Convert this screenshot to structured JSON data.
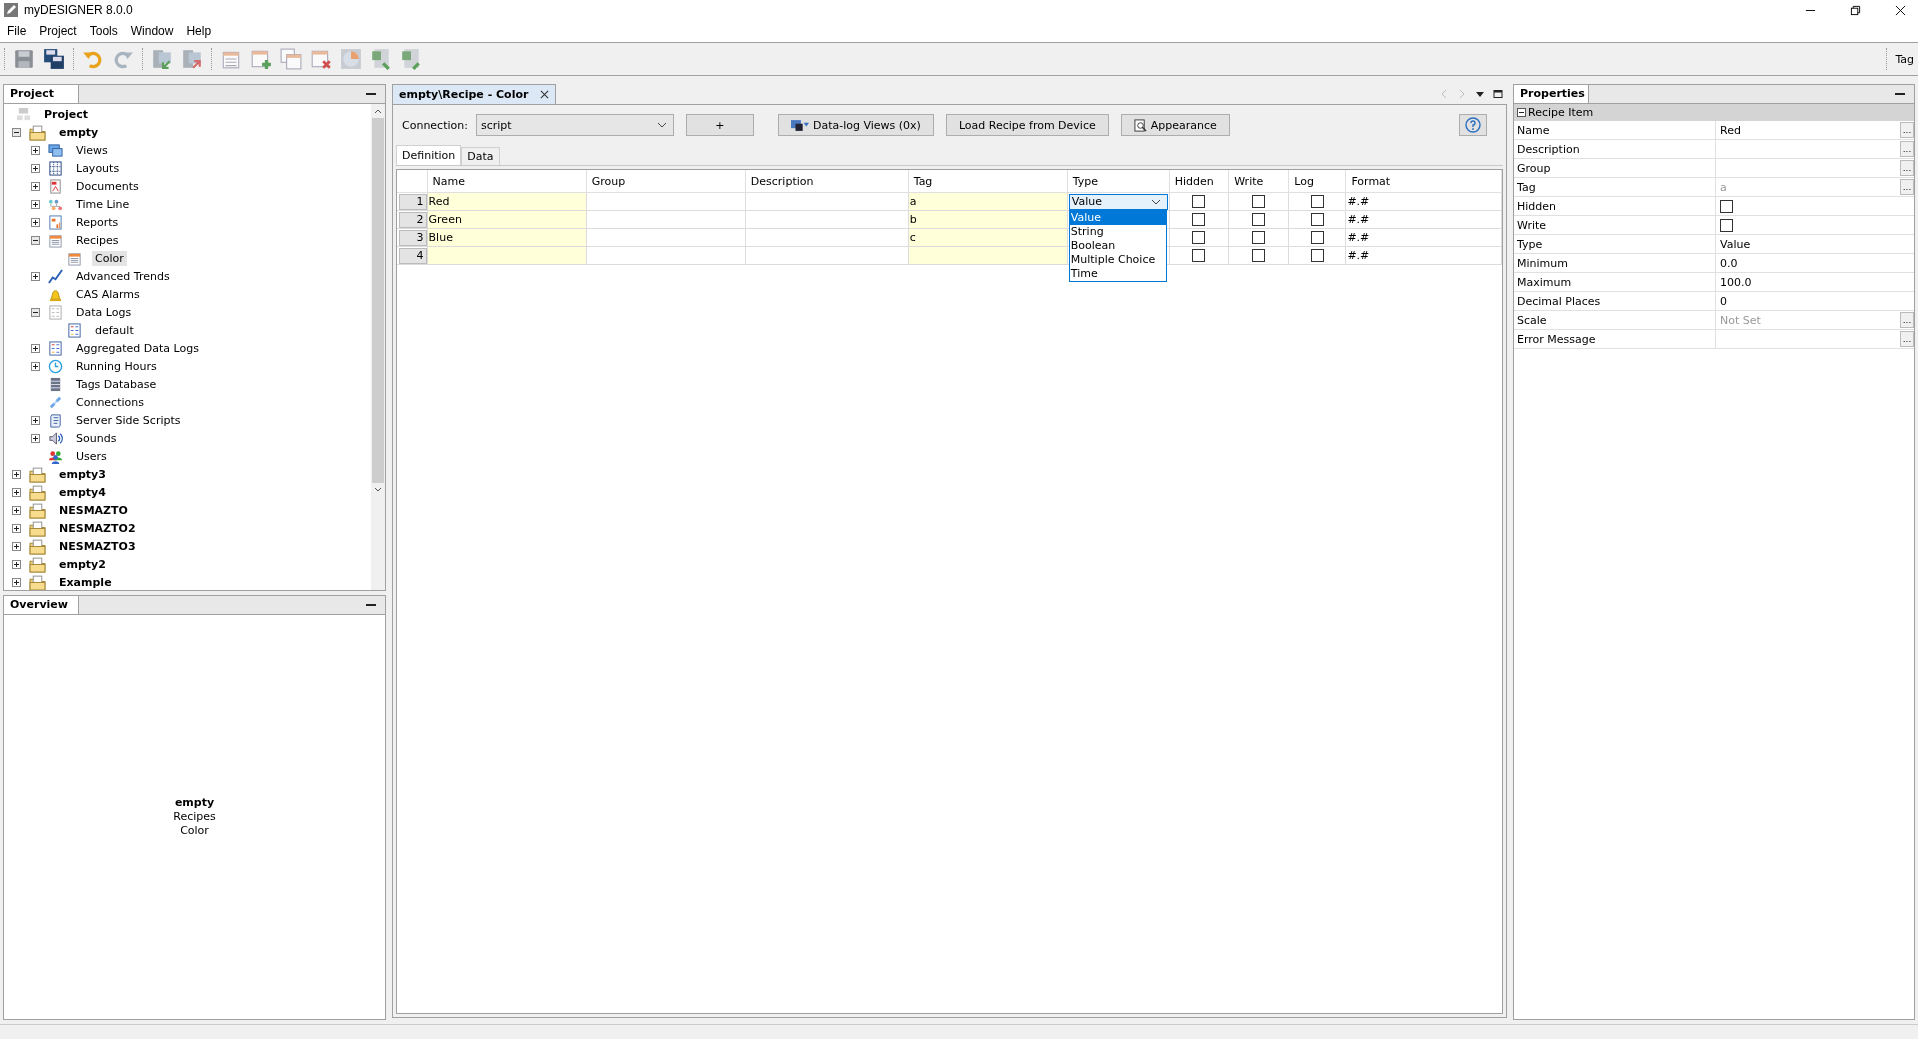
{
  "app": {
    "title": "myDESIGNER 8.0.0"
  },
  "menu": [
    "File",
    "Project",
    "Tools",
    "Window",
    "Help"
  ],
  "toolbar": {
    "label": "Tag"
  },
  "project_panel": {
    "title": "Project",
    "root": "Project",
    "tree": [
      {
        "label": "empty",
        "kind": "folder",
        "bold": true,
        "expanded": true,
        "selected": false,
        "children": [
          {
            "label": "Views",
            "kind": "views",
            "bold": false,
            "expanded": false,
            "selected": false
          },
          {
            "label": "Layouts",
            "kind": "layouts",
            "bold": false,
            "expanded": false,
            "selected": false
          },
          {
            "label": "Documents",
            "kind": "documents",
            "bold": false,
            "expanded": false,
            "selected": false
          },
          {
            "label": "Time Line",
            "kind": "timeline",
            "bold": false,
            "expanded": false,
            "selected": false
          },
          {
            "label": "Reports",
            "kind": "reports",
            "bold": false,
            "expanded": false,
            "selected": false
          },
          {
            "label": "Recipes",
            "kind": "recipe",
            "bold": false,
            "expanded": true,
            "selected": false,
            "children": [
              {
                "label": "Color",
                "kind": "recipe",
                "bold": false,
                "selected": true
              }
            ]
          },
          {
            "label": "Advanced Trends",
            "kind": "trends",
            "bold": false,
            "expanded": false,
            "selected": false
          },
          {
            "label": "CAS Alarms",
            "kind": "alarm",
            "bold": false,
            "selected": false
          },
          {
            "label": "Data Logs",
            "kind": "datalogs",
            "bold": false,
            "expanded": true,
            "selected": false,
            "children": [
              {
                "label": "default",
                "kind": "datalog",
                "bold": false,
                "selected": false
              }
            ]
          },
          {
            "label": "Aggregated Data Logs",
            "kind": "datalog",
            "bold": false,
            "expanded": false,
            "selected": false
          },
          {
            "label": "Running Hours",
            "kind": "clock",
            "bold": false,
            "expanded": false,
            "selected": false
          },
          {
            "label": "Tags Database",
            "kind": "database",
            "bold": false,
            "selected": false
          },
          {
            "label": "Connections",
            "kind": "link",
            "bold": false,
            "selected": false
          },
          {
            "label": "Server Side Scripts",
            "kind": "scripts",
            "bold": false,
            "expanded": false,
            "selected": false
          },
          {
            "label": "Sounds",
            "kind": "sounds",
            "bold": false,
            "expanded": false,
            "selected": false
          },
          {
            "label": "Users",
            "kind": "users",
            "bold": false,
            "selected": false
          }
        ]
      },
      {
        "label": "empty3",
        "kind": "folder",
        "bold": true,
        "expanded": false,
        "selected": false
      },
      {
        "label": "empty4",
        "kind": "folder",
        "bold": true,
        "expanded": false,
        "selected": false
      },
      {
        "label": "NESMAZTO",
        "kind": "folder",
        "bold": true,
        "expanded": false,
        "selected": false
      },
      {
        "label": "NESMAZTO2",
        "kind": "folder",
        "bold": true,
        "expanded": false,
        "selected": false
      },
      {
        "label": "NESMAZTO3",
        "kind": "folder",
        "bold": true,
        "expanded": false,
        "selected": false
      },
      {
        "label": "empty2",
        "kind": "folder",
        "bold": true,
        "expanded": false,
        "selected": false
      },
      {
        "label": "Example",
        "kind": "folder",
        "bold": true,
        "expanded": false,
        "selected": false
      }
    ]
  },
  "overview": {
    "title": "Overview",
    "lines": [
      "empty",
      "Recipes",
      "Color"
    ]
  },
  "editor": {
    "tab": "empty\\Recipe - Color",
    "connection_label": "Connection:",
    "connection_value": "script",
    "buttons": [
      {
        "label": "+",
        "kind": "plain"
      },
      {
        "label": "Data-log Views (0x)",
        "kind": "datalog"
      },
      {
        "label": "Load Recipe from Device",
        "kind": "plain"
      },
      {
        "label": "Appearance",
        "kind": "appearance"
      }
    ],
    "subtabs": [
      {
        "label": "Definition",
        "selected": true
      },
      {
        "label": "Data",
        "selected": false
      }
    ],
    "columns": [
      {
        "label": "Name",
        "required": true
      },
      {
        "label": "Group",
        "required": false
      },
      {
        "label": "Description",
        "required": false
      },
      {
        "label": "Tag",
        "required": true
      },
      {
        "label": "Type",
        "required": false
      },
      {
        "label": "Hidden",
        "required": false
      },
      {
        "label": "Write",
        "required": false
      },
      {
        "label": "Log",
        "required": false
      },
      {
        "label": "Format",
        "required": false
      }
    ],
    "rows": [
      {
        "index": "1",
        "name": "Red",
        "tag": "a",
        "type": "Value",
        "hidden": false,
        "write": false,
        "log": false,
        "format": "#.#"
      },
      {
        "index": "2",
        "name": "Green",
        "tag": "b",
        "hidden": false,
        "write": false,
        "log": false,
        "format": "#.#"
      },
      {
        "index": "3",
        "name": "Blue",
        "tag": "c",
        "hidden": false,
        "write": false,
        "log": false,
        "format": "#.#"
      },
      {
        "index": "4",
        "hidden": false,
        "write": false,
        "log": false,
        "format": "#.#"
      }
    ],
    "type_options": [
      {
        "label": "Value",
        "selected": true
      },
      {
        "label": "String",
        "selected": false
      },
      {
        "label": "Boolean",
        "selected": false
      },
      {
        "label": "Multiple Choice",
        "selected": false
      },
      {
        "label": "Time",
        "selected": false
      }
    ]
  },
  "properties": {
    "title": "Properties",
    "category": "Recipe Item",
    "rows": [
      {
        "label": "Name",
        "kind": "text",
        "value": "Red",
        "button": "..."
      },
      {
        "label": "Description",
        "kind": "text",
        "button": "..."
      },
      {
        "label": "Group",
        "kind": "text",
        "button": "..."
      },
      {
        "label": "Tag",
        "kind": "muted",
        "value": "a",
        "button": "..."
      },
      {
        "label": "Hidden",
        "kind": "checkbox",
        "checked": false
      },
      {
        "label": "Write",
        "kind": "checkbox",
        "checked": false
      },
      {
        "label": "Type",
        "kind": "text",
        "value": "Value"
      },
      {
        "label": "Minimum",
        "kind": "text",
        "value": "0.0"
      },
      {
        "label": "Maximum",
        "kind": "text",
        "value": "100.0"
      },
      {
        "label": "Decimal Places",
        "kind": "text",
        "value": "0"
      },
      {
        "label": "Scale",
        "kind": "muted",
        "value": "Not Set",
        "button": "..."
      },
      {
        "label": "Error Message",
        "kind": "text",
        "button": "..."
      }
    ]
  }
}
